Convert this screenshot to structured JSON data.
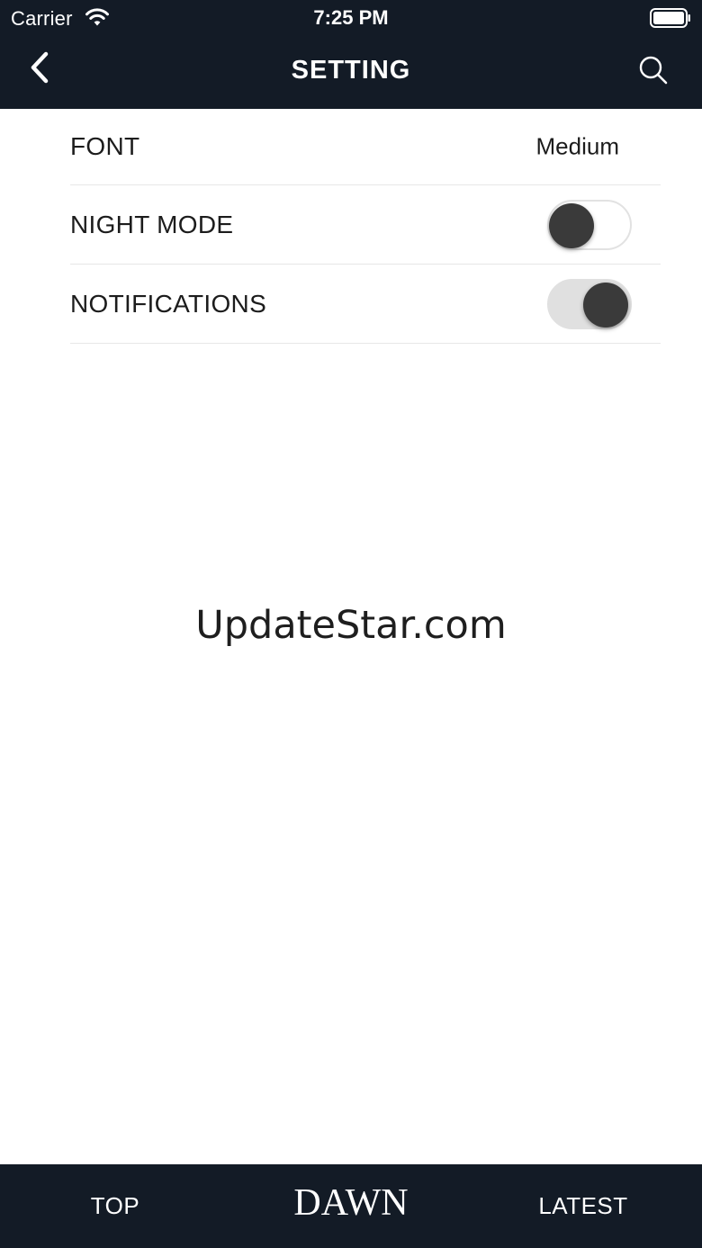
{
  "status_bar": {
    "carrier": "Carrier",
    "time": "7:25 PM",
    "wifi_icon": "wifi-icon",
    "battery_icon": "battery-icon"
  },
  "nav": {
    "title": "SETTING",
    "back_icon": "chevron-left-icon",
    "search_icon": "search-icon"
  },
  "settings": {
    "font": {
      "label": "FONT",
      "value": "Medium"
    },
    "night_mode": {
      "label": "NIGHT MODE",
      "enabled": false
    },
    "notifications": {
      "label": "NOTIFICATIONS",
      "enabled": true
    }
  },
  "watermark": "UpdateStar.com",
  "tab_bar": {
    "top_label": "TOP",
    "logo_text": "DAWN",
    "latest_label": "LATEST"
  },
  "colors": {
    "header_bg": "#131b26",
    "toggle_knob": "#3a3a3a",
    "divider": "#e7e7e7"
  }
}
